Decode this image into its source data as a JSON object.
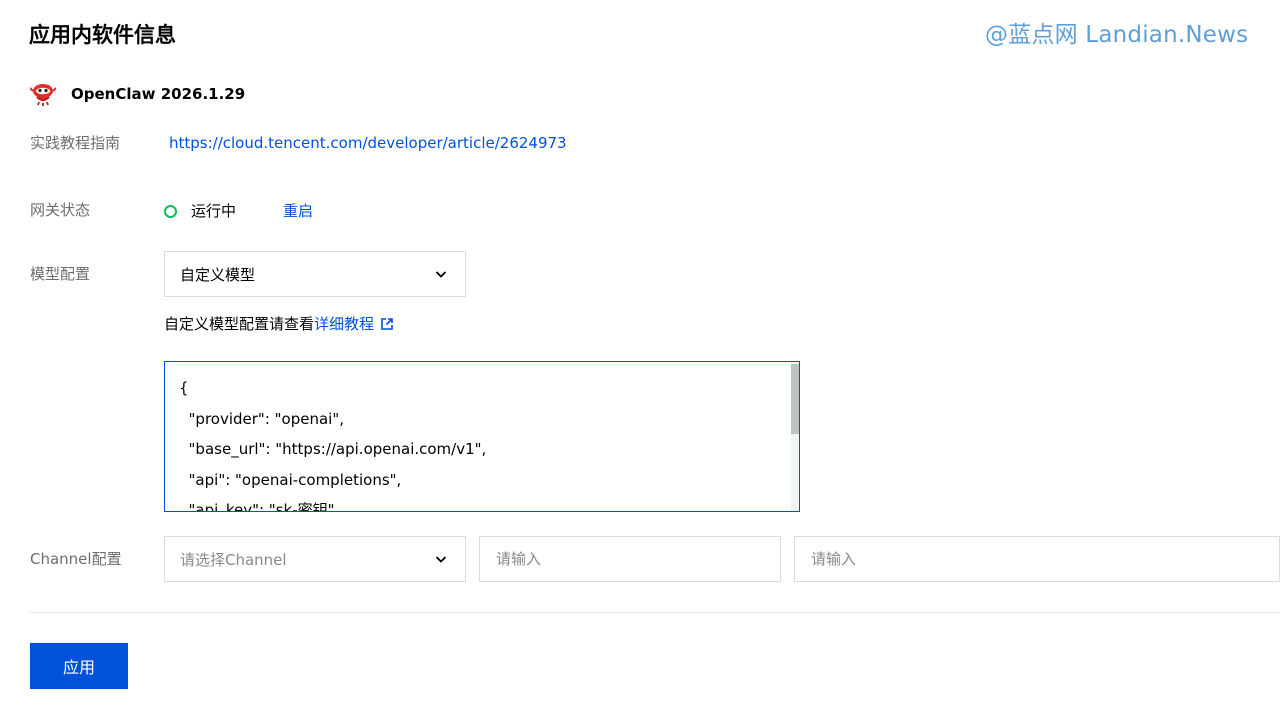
{
  "header": {
    "title": "应用内软件信息",
    "watermark": "@蓝点网 Landian.News"
  },
  "app": {
    "name": "OpenClaw 2026.1.29",
    "logo_icon": "red-claw-mascot-icon"
  },
  "tutorial": {
    "label": "实践教程指南",
    "url": "https://cloud.tencent.com/developer/article/2624973"
  },
  "gateway": {
    "label": "网关状态",
    "status": "运行中",
    "status_color": "#0abf5b",
    "restart_label": "重启"
  },
  "model": {
    "label": "模型配置",
    "selected": "自定义模型",
    "hint_prefix": "自定义模型配置请查看",
    "hint_link": "详细教程",
    "config_text": "{\n  \"provider\": \"openai\",\n  \"base_url\": \"https://api.openai.com/v1\",\n  \"api\": \"openai-completions\",\n  \"api_key\": \"sk-密钥\","
  },
  "channel": {
    "label": "Channel配置",
    "select_placeholder": "请选择Channel",
    "input1_placeholder": "请输入",
    "input2_placeholder": "请输入"
  },
  "actions": {
    "apply_label": "应用"
  },
  "colors": {
    "primary": "#0052d9",
    "success": "#0abf5b",
    "label_gray": "#6e6e6e",
    "watermark": "#5d9fd6"
  }
}
